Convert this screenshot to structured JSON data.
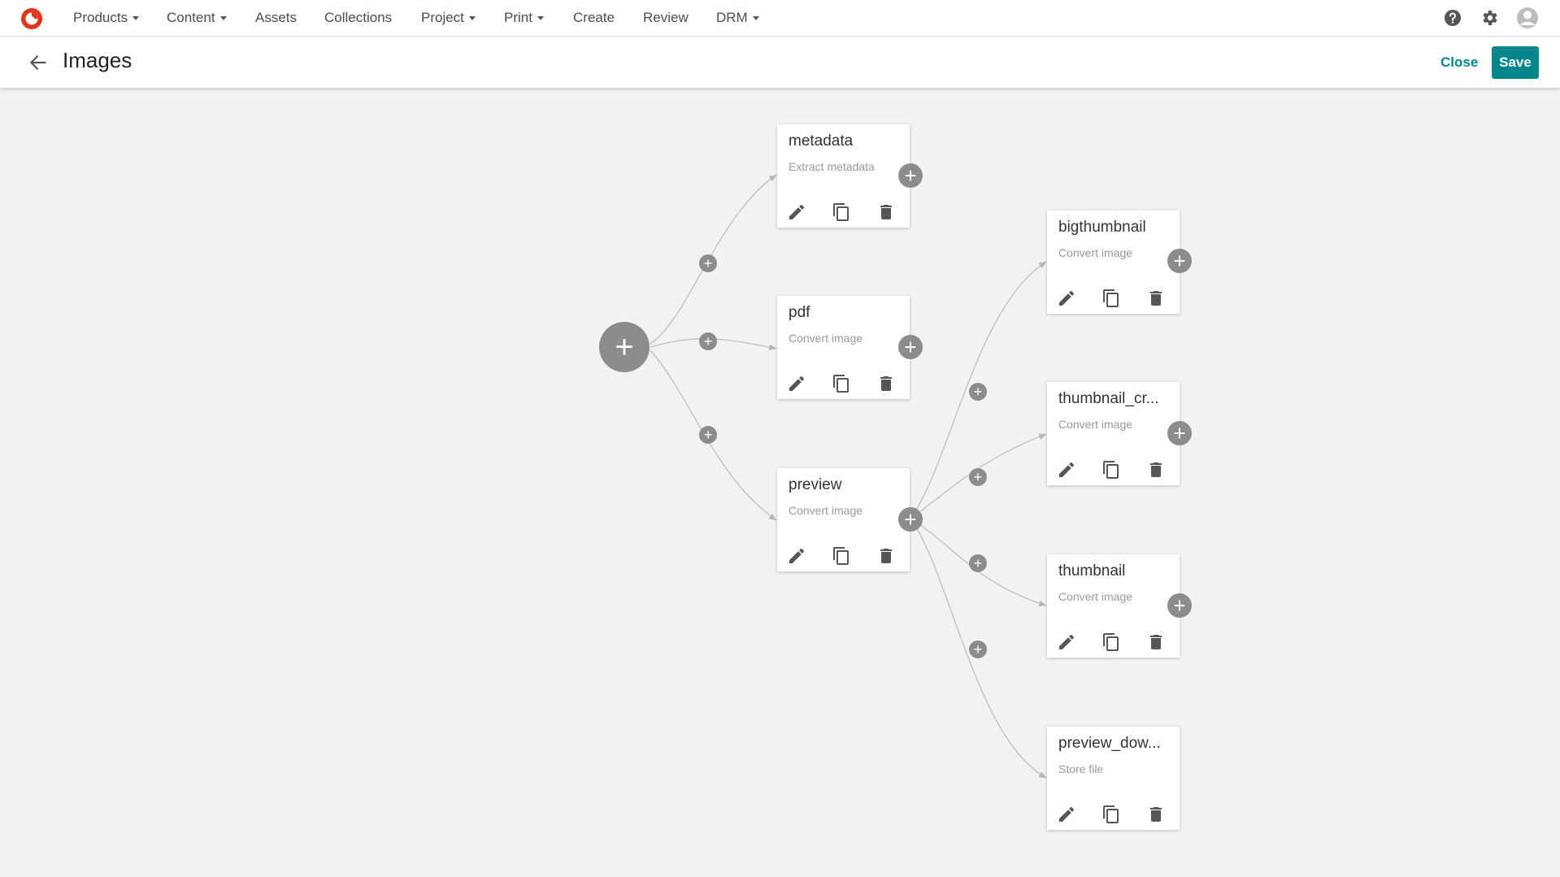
{
  "app": {
    "nav": [
      {
        "label": "Products",
        "has_dropdown": true
      },
      {
        "label": "Content",
        "has_dropdown": true
      },
      {
        "label": "Assets",
        "has_dropdown": false
      },
      {
        "label": "Collections",
        "has_dropdown": false
      },
      {
        "label": "Project",
        "has_dropdown": true
      },
      {
        "label": "Print",
        "has_dropdown": true
      },
      {
        "label": "Create",
        "has_dropdown": false
      },
      {
        "label": "Review",
        "has_dropdown": false
      },
      {
        "label": "DRM",
        "has_dropdown": true
      }
    ],
    "icons": {
      "help": "help-circle-icon",
      "settings": "gear-icon",
      "account": "user-avatar-icon"
    },
    "brand_color": "#e8331e"
  },
  "header": {
    "title": "Images",
    "close_label": "Close",
    "save_label": "Save",
    "accent": "#00868b"
  },
  "workflow": {
    "root_add_glyph": "+",
    "nodes": [
      {
        "id": "metadata",
        "title": "metadata",
        "subtitle": "Extract metadata"
      },
      {
        "id": "pdf",
        "title": "pdf",
        "subtitle": "Convert image"
      },
      {
        "id": "preview",
        "title": "preview",
        "subtitle": "Convert image"
      },
      {
        "id": "bigthumbnail",
        "title": "bigthumbnail",
        "subtitle": "Convert image"
      },
      {
        "id": "thumbnail_cr",
        "title": "thumbnail_cr...",
        "subtitle": "Convert image"
      },
      {
        "id": "thumbnail",
        "title": "thumbnail",
        "subtitle": "Convert image"
      },
      {
        "id": "preview_dow",
        "title": "preview_dow...",
        "subtitle": "Store file"
      }
    ],
    "edges": [
      {
        "from": "root",
        "to": "metadata"
      },
      {
        "from": "root",
        "to": "pdf"
      },
      {
        "from": "root",
        "to": "preview"
      },
      {
        "from": "preview",
        "to": "bigthumbnail"
      },
      {
        "from": "preview",
        "to": "thumbnail_cr"
      },
      {
        "from": "preview",
        "to": "thumbnail"
      },
      {
        "from": "preview",
        "to": "preview_dow"
      }
    ],
    "node_actions": [
      "edit-icon",
      "copy-icon",
      "delete-icon"
    ]
  }
}
